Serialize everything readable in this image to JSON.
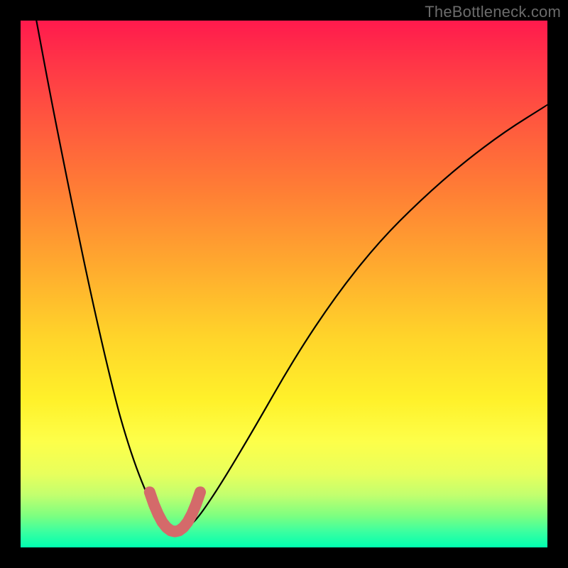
{
  "watermark": "TheBottleneck.com",
  "colors": {
    "background": "#000000",
    "curve": "#000000",
    "highlight": "#d46a6a",
    "gradient_top": "#ff1a4d",
    "gradient_bottom": "#00ffb0"
  },
  "chart_data": {
    "type": "line",
    "title": "",
    "xlabel": "",
    "ylabel": "",
    "xlim": [
      0,
      100
    ],
    "ylim": [
      0,
      100
    ],
    "axes_visible": false,
    "grid": false,
    "series": [
      {
        "name": "curve",
        "x": [
          3,
          6,
          10,
          14,
          18,
          20,
          22,
          24,
          26,
          27,
          28,
          29,
          30,
          31,
          32,
          34,
          38,
          44,
          52,
          60,
          68,
          76,
          84,
          92,
          100
        ],
        "y": [
          100,
          84,
          64,
          45,
          28,
          21,
          15,
          10,
          6,
          4,
          3,
          2.5,
          2.5,
          3,
          4,
          6,
          12,
          22,
          36,
          48,
          58,
          66,
          73,
          79,
          84
        ]
      }
    ],
    "highlight": {
      "name": "bottom-notch",
      "x": [
        24.5,
        25.3,
        26.1,
        26.9,
        27.7,
        28.5,
        29.3,
        30.1,
        30.9,
        31.7,
        32.5,
        33.3,
        34.1
      ],
      "y": [
        10.5,
        8.2,
        6.3,
        4.8,
        3.8,
        3.2,
        3.0,
        3.2,
        3.8,
        4.8,
        6.3,
        8.2,
        10.5
      ]
    }
  }
}
